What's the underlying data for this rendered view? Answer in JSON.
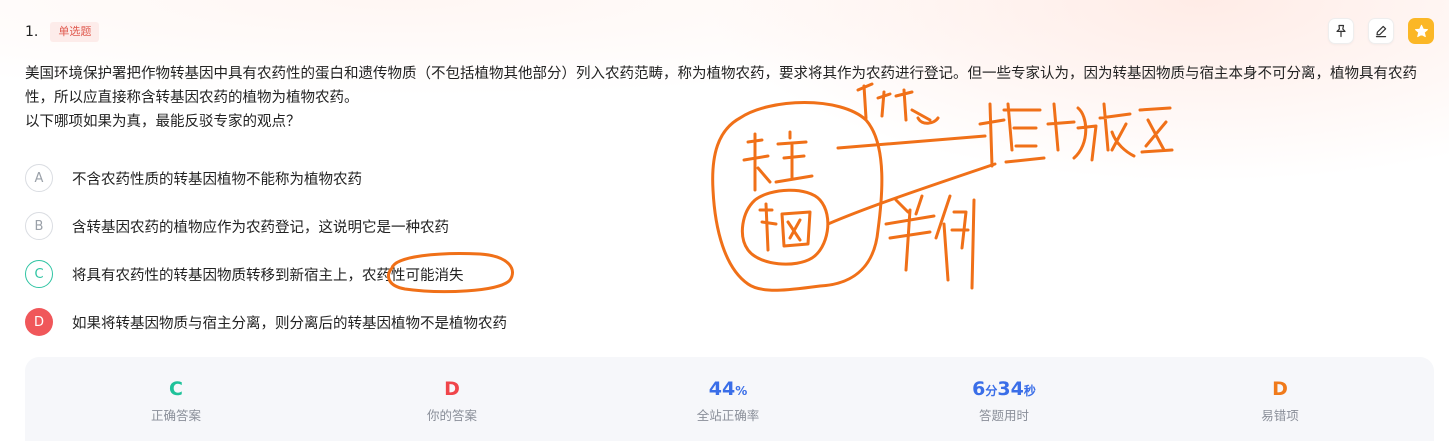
{
  "question": {
    "number": "1.",
    "type_badge": "单选题",
    "stem_line1": "美国环境保护署把作物转基因中具有农药性的蛋白和遗传物质（不包括植物其他部分）列入农药范畴，称为植物农药，要求将其作为农药进行登记。但一些专家认为，因为转基因物质与宿主本身不可分离，植物具有农药性，所以应直接称含转基因农药的植物为植物农药。",
    "stem_line2": "以下哪项如果为真，最能反驳专家的观点？"
  },
  "toolbar": {
    "pin_icon": "pin-icon",
    "edit_icon": "pencil-icon",
    "favorite_icon": "star-icon",
    "favorite_color": "#fbb726"
  },
  "options": [
    {
      "letter": "A",
      "text": "不含农药性质的转基因植物不能称为植物农药",
      "state": "normal"
    },
    {
      "letter": "B",
      "text": "含转基因农药的植物应作为农药登记，这说明它是一种农药",
      "state": "normal"
    },
    {
      "letter": "C",
      "text": "将具有农药性的转基因物质转移到新宿主上，农药性可能消失",
      "state": "correct"
    },
    {
      "letter": "D",
      "text": "如果将转基因物质与宿主分离，则分离后的转基因植物不是植物农药",
      "state": "wrong"
    }
  ],
  "stats": {
    "correct_answer": {
      "value": "C",
      "label": "正确答案",
      "color": "#1fc29a"
    },
    "your_answer": {
      "value": "D",
      "label": "你的答案",
      "color": "#f0454a"
    },
    "accuracy": {
      "value": "44",
      "unit": "%",
      "label": "全站正确率",
      "color": "#3a6ee8"
    },
    "time_used": {
      "min": "6",
      "min_unit": "分",
      "sec": "34",
      "sec_unit": "秒",
      "label": "答题用时",
      "color": "#3a6ee8"
    },
    "common_wrong": {
      "value": "D",
      "label": "易错项",
      "color": "#f07a1a"
    }
  },
  "annotation_color": "#f07018"
}
